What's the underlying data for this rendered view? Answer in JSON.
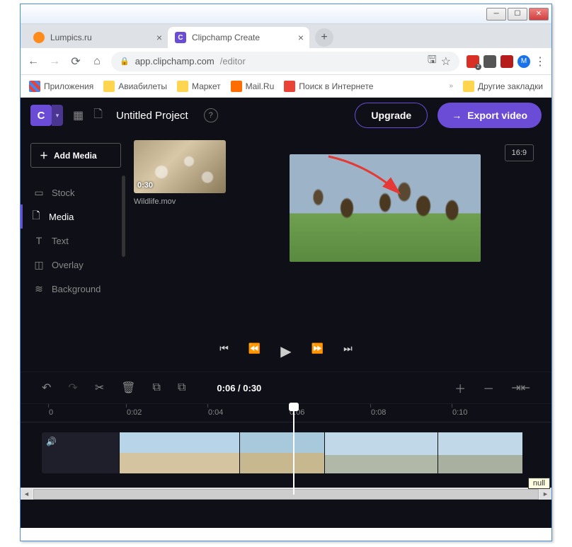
{
  "browser": {
    "tabs": [
      {
        "label": "Lumpics.ru",
        "active": false
      },
      {
        "label": "Clipchamp Create",
        "active": true
      }
    ],
    "url_host": "app.clipchamp.com",
    "url_path": "/editor",
    "avatar_letter": "M",
    "bookmarks": {
      "apps": "Приложения",
      "flights": "Авиабилеты",
      "market": "Маркет",
      "mail": "Mail.Ru",
      "search": "Поиск в Интернете",
      "more": "»",
      "other": "Другие закладки"
    }
  },
  "app": {
    "logo_letter": "C",
    "title": "Untitled Project",
    "upgrade": "Upgrade",
    "export": "Export video",
    "add_media": "Add Media",
    "aspect_ratio": "16:9",
    "sidebar": {
      "stock": "Stock",
      "media": "Media",
      "text": "Text",
      "overlay": "Overlay",
      "background": "Background"
    },
    "media_item": {
      "duration": "0:30",
      "filename": "Wildlife.mov"
    },
    "time_counter": "0:06 / 0:30",
    "ruler": {
      "t0": "0",
      "t1": "0:02",
      "t2": "0:04",
      "t3": "0:06",
      "t4": "0:08",
      "t5": "0:10"
    },
    "tooltip": "null"
  }
}
